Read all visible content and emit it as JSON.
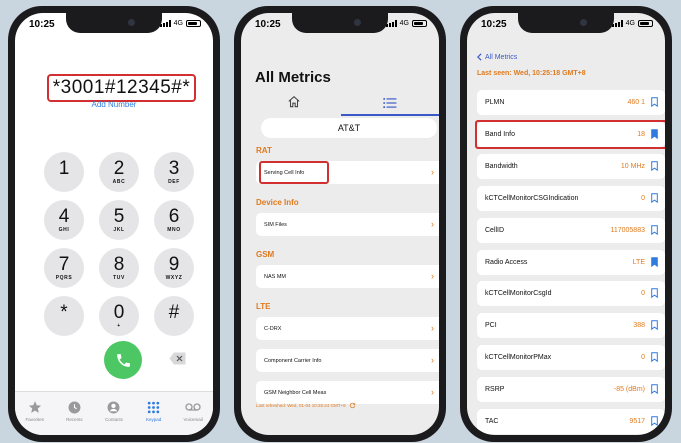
{
  "phone1": {
    "time": "10:25",
    "network": "4G",
    "dial_value": "*3001#12345#*",
    "add_number": "Add Number",
    "keys": [
      {
        "digit": "1",
        "letters": ""
      },
      {
        "digit": "2",
        "letters": "ABC"
      },
      {
        "digit": "3",
        "letters": "DEF"
      },
      {
        "digit": "4",
        "letters": "GHI"
      },
      {
        "digit": "5",
        "letters": "JKL"
      },
      {
        "digit": "6",
        "letters": "MNO"
      },
      {
        "digit": "7",
        "letters": "PQRS"
      },
      {
        "digit": "8",
        "letters": "TUV"
      },
      {
        "digit": "9",
        "letters": "WXYZ"
      },
      {
        "digit": "*",
        "letters": ""
      },
      {
        "digit": "0",
        "letters": "+"
      },
      {
        "digit": "#",
        "letters": ""
      }
    ],
    "tabs": [
      {
        "label": "Favorites",
        "icon": "star-icon"
      },
      {
        "label": "Recents",
        "icon": "clock-icon"
      },
      {
        "label": "Contacts",
        "icon": "person-icon"
      },
      {
        "label": "Keypad",
        "icon": "keypad-icon"
      },
      {
        "label": "Voicemail",
        "icon": "voicemail-icon"
      }
    ],
    "accent": "#2f7be0",
    "call_color": "#4cc764"
  },
  "phone2": {
    "time": "10:25",
    "network": "4G",
    "title": "All Metrics",
    "carrier": "AT&T",
    "sections": [
      {
        "title": "RAT",
        "items": [
          "Serving Cell Info"
        ]
      },
      {
        "title": "Device Info",
        "items": [
          "SIM Files"
        ]
      },
      {
        "title": "GSM",
        "items": [
          "NAS MM"
        ]
      },
      {
        "title": "LTE",
        "items": [
          "C-DRX",
          "Component Carrier Info",
          "GSM Neighbor Cell Meas"
        ]
      }
    ],
    "last_refreshed": "Last refreshed: Wed, 01-04 10:25:24 GMT+8",
    "accent": "#e07a1e"
  },
  "phone3": {
    "time": "10:25",
    "network": "4G",
    "back_label": "All Metrics",
    "last_seen": "Last seen: Wed, 10:25:18 GMT+8",
    "rows": [
      {
        "label": "PLMN",
        "value": "460 1",
        "bookmarked": false
      },
      {
        "label": "Band Info",
        "value": "18",
        "bookmarked": true
      },
      {
        "label": "Bandwidth",
        "value": "10 MHz",
        "bookmarked": false
      },
      {
        "label": "kCTCellMonitorCSGIndication",
        "value": "0",
        "bookmarked": false
      },
      {
        "label": "CellID",
        "value": "117005883",
        "bookmarked": false
      },
      {
        "label": "Radio Access",
        "value": "LTE",
        "bookmarked": true
      },
      {
        "label": "kCTCellMonitorCsgId",
        "value": "0",
        "bookmarked": false
      },
      {
        "label": "PCI",
        "value": "388",
        "bookmarked": false
      },
      {
        "label": "kCTCellMonitorPMax",
        "value": "0",
        "bookmarked": false
      },
      {
        "label": "RSRP",
        "value": "-85 (dBm)",
        "bookmarked": false
      },
      {
        "label": "TAC",
        "value": "9517",
        "bookmarked": false
      }
    ],
    "bookmark_color": "#2f7be0"
  }
}
